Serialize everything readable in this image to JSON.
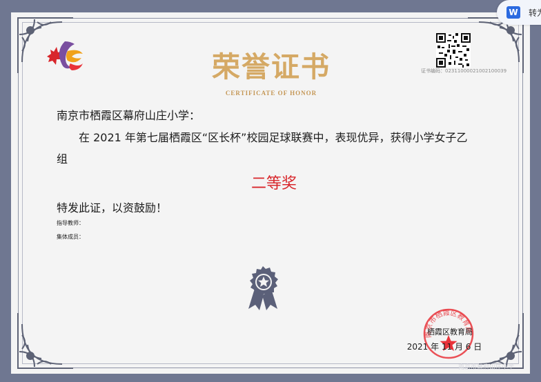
{
  "certificate": {
    "title": "荣誉证书",
    "subtitle": "CERTIFICATE OF HONOR",
    "cert_no": "证书编码：02311000021002100039",
    "recipient": "南京市栖霞区幕府山庄小学：",
    "body_line1": "在 2021 年第七届栖霞区“区长杯”校园足球联赛中，表现优异，获得小学女子乙",
    "body_line2": "组",
    "award": "二等奖",
    "closing": "特发此证，以资鼓励！",
    "teacher_label": "指导教师：",
    "members_label": "集体成员：",
    "issuer": "栖霞区教育局",
    "seal_text": "南京市栖霞区教育局",
    "date": "2021 年 11 月 6 日",
    "footer_faint": "南京市幕府山庄小学"
  },
  "word_badge": {
    "icon": "W",
    "label": "转为"
  },
  "colors": {
    "title_gold": "#d5a965",
    "award_red": "#d8262b",
    "seal_red": "#e8333a",
    "frame_gray": "#6f7791"
  },
  "icons": [
    "logo-icon",
    "qr-code-icon",
    "medal-icon",
    "official-seal-icon",
    "word-icon"
  ]
}
